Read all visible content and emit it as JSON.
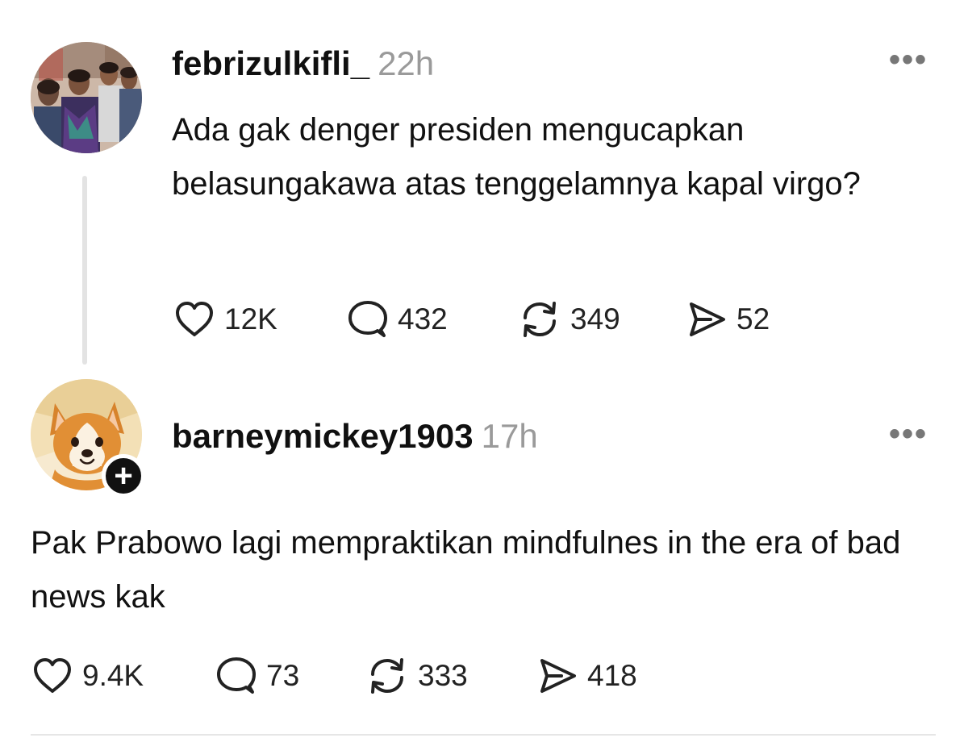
{
  "posts": [
    {
      "username": "febrizulkifli_",
      "time": "22h",
      "body": "Ada gak denger presiden mengucapkan belasungakawa atas tenggelamnya kapal virgo?",
      "likes": "12K",
      "replies": "432",
      "reposts": "349",
      "shares": "52",
      "avatar": "group-photo"
    },
    {
      "username": "barneymickey1903",
      "time": "17h",
      "body": "Pak Prabowo lagi mempraktikan mindfulnes in the era of bad news kak",
      "likes": "9.4K",
      "replies": "73",
      "reposts": "333",
      "shares": "418",
      "avatar": "cartoon-corgi",
      "follow_badge": "+"
    }
  ],
  "more_label": "•••",
  "icons": {
    "like": "heart-icon",
    "reply": "comment-bubble-icon",
    "repost": "repost-arrows-icon",
    "share": "send-arrow-icon",
    "more": "more-dots-icon"
  },
  "colors": {
    "text": "#101010",
    "muted": "#9a9a9a",
    "thread_line": "#e3e3e3",
    "badge": "#111111"
  }
}
